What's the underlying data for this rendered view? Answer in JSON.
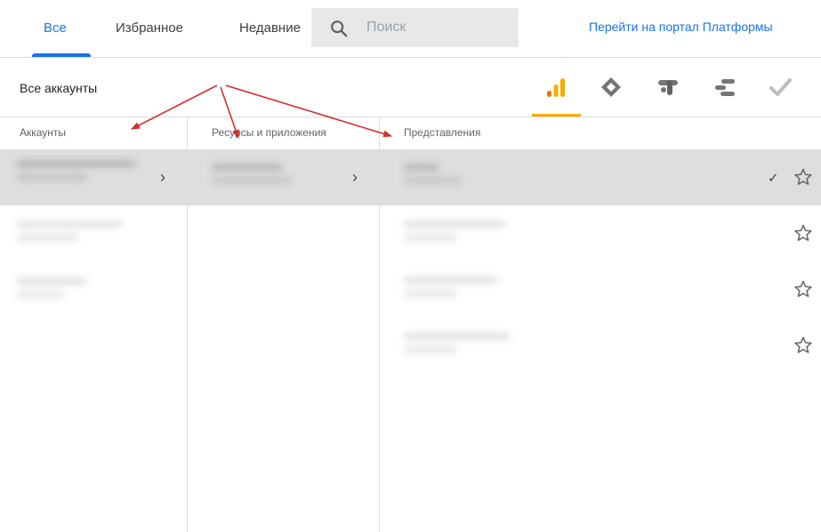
{
  "tabs": [
    {
      "label": "Все",
      "active": true
    },
    {
      "label": "Избранное",
      "active": false
    },
    {
      "label": "Недавние",
      "active": false
    }
  ],
  "search": {
    "placeholder": "Поиск"
  },
  "portal_link": "Перейти на портал Платформы",
  "scope_label": "Все аккаунты",
  "products": [
    {
      "icon": "analytics-icon",
      "selected": true
    },
    {
      "icon": "tag-manager-icon",
      "selected": false
    },
    {
      "icon": "optimize-icon",
      "selected": false
    },
    {
      "icon": "data-studio-icon",
      "selected": false
    },
    {
      "icon": "surveys-icon",
      "selected": false
    }
  ],
  "columns": {
    "accounts": {
      "header": "Аккаунты"
    },
    "properties": {
      "header": "Ресурсы и приложения"
    },
    "views": {
      "header": "Представления"
    }
  },
  "colors": {
    "accent": "#1a73e8",
    "product_accent": "#f9ab00",
    "annotation_arrow": "#d32f2f"
  }
}
